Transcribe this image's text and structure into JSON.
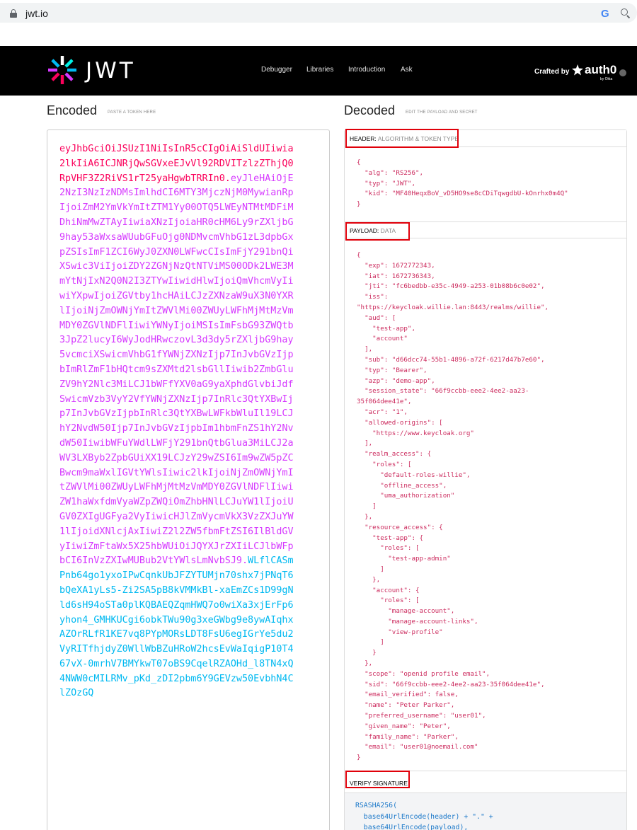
{
  "browser": {
    "url": "jwt.io",
    "google_icon": "G"
  },
  "header": {
    "logo_text": "JWT",
    "nav": [
      "Debugger",
      "Libraries",
      "Introduction",
      "Ask"
    ],
    "crafted_by": "Crafted by",
    "brand": "auth0",
    "brand_sub": "by Okta"
  },
  "encoded": {
    "title": "Encoded",
    "subtitle": "PASTE A TOKEN HERE",
    "token_header": "eyJhbGciOiJSUzI1NiIsInR5cCIgOiAiSldUIiwia2lkIiA6ICJNRjQwSGVxeEJvVl92RDVITzlzZThjQ0RpVHF3Z2RiVS1rT25yaHgwbTRRIn0",
    "token_payload": "eyJleHAiOjE2NzI3NzIzNDMsImlhdCI6MTY3MjczNjM0MywianRpIjoiZmM2YmVkYmItZTM1Yy00OTQ5LWEyNTMtMDFiMDhiNmMwZTAyIiwiaXNzIjoiaHR0cHM6Ly9rZXljbG9hay53aWxsaWUubGFuOjg0NDMvcmVhbG1zL3dpbGxpZSIsImF1ZCI6WyJ0ZXN0LWFwcCIsImFjY291bnQiXSwic3ViIjoiZDY2ZGNjNzQtNTViMS00ODk2LWE3MmYtNjIxN2Q0N2I3ZTYwIiwidHlwIjoiQmVhcmVyIiwiYXpwIjoiZGVtby1hcHAiLCJzZXNzaW9uX3N0YXRlIjoiNjZmOWNjYmItZWVlMi00ZWUyLWFhMjMtMzVmMDY0ZGVlNDFlIiwiYWNyIjoiMSIsImFsbG93ZWQtb3JpZ2lucyI6WyJodHRwczovL3d3dy5rZXljbG9hay5vcmciXSwicmVhbG1fYWNjZXNzIjp7InJvbGVzIjpbImRlZmF1bHQtcm9sZXMtd2lsbGllIiwib2ZmbGluZV9hY2Nlc3MiLCJ1bWFfYXV0aG9yaXphdGlvbiJdfSwicmVzb3VyY2VfYWNjZXNzIjp7InRlc3QtYXBwIjp7InJvbGVzIjpbInRlc3QtYXBwLWFkbWluIl19LCJhY2NvdW50Ijp7InJvbGVzIjpbIm1hbmFnZS1hY2NvdW50IiwibWFuYWdlLWFjY291bnQtbGlua3MiLCJ2aWV3LXByb2ZpbGUiXX19LCJzY29wZSI6Im9wZW5pZCBwcm9maWxlIGVtYWlsIiwic2lkIjoiNjZmOWNjYmItZWVlMi00ZWUyLWFhMjMtMzVmMDY0ZGVlNDFlIiwiZW1haWxfdmVyaWZpZWQiOmZhbHNlLCJuYW1lIjoiUGV0ZXIgUGFya2VyIiwicHJlZmVycmVkX3VzZXJuYW1lIjoidXNlcjAxIiwiZ2l2ZW5fbmFtZSI6IlBldGVyIiwiZmFtaWx5X25hbWUiOiJQYXJrZXIiLCJlbWFpbCI6InVzZXIwMUBub2VtYWlsLmNvbSJ9",
    "token_signature": "WLflCASmPnb64go1yxoIPwCqnkUbJFZYTUMjn70shx7jPNqT6bQeXA1yLs5-Zi2SA5pB8kVMMkBl-xaEmZCs1D99gNld6sH94oSTa0plKQBAEQZqmHWQ7o0wiXa3xjErFp6yhon4_GMHKUCgi6obkTWu90g3xeGWbg9e8ywAIqhxAZOrRLfR1KE7vq8PYpMORsLDT8FsU6egIGrYe5du2VyRITfhjdyZ0WllWbBZuHRoW2hcsEvWaIqigP10T467vX-0mrhV7BMYkwT07oBS9CqelRZAOHd_l8TN4xQ4NWW0cMILRMv_pKd_zDI2pbm6Y9GEVzw50EvbhN4ClZOzGQ",
    "dot": "."
  },
  "decoded": {
    "title": "Decoded",
    "subtitle": "EDIT THE PAYLOAD AND SECRET",
    "header_section": {
      "label": "HEADER:",
      "muted": "ALGORITHM & TOKEN TYPE"
    },
    "header_json": "{\n  \"alg\": \"RS256\",\n  \"typ\": \"JWT\",\n  \"kid\": \"MF40HeqxBoV_vD5HO9se8cCDiTqwgdbU-kOnrhx0m4Q\"\n}",
    "payload_section": {
      "label": "PAYLOAD:",
      "muted": "DATA"
    },
    "payload_json": "{\n  \"exp\": 1672772343,\n  \"iat\": 1672736343,\n  \"jti\": \"fc6bedbb-e35c-4949-a253-01b08b6c0e02\",\n  \"iss\":\n\"https://keycloak.willie.lan:8443/realms/willie\",\n  \"aud\": [\n    \"test-app\",\n    \"account\"\n  ],\n  \"sub\": \"d66dcc74-55b1-4896-a72f-6217d47b7e60\",\n  \"typ\": \"Bearer\",\n  \"azp\": \"demo-app\",\n  \"session_state\": \"66f9ccbb-eee2-4ee2-aa23-\n35f064dee41e\",\n  \"acr\": \"1\",\n  \"allowed-origins\": [\n    \"https://www.keycloak.org\"\n  ],\n  \"realm_access\": {\n    \"roles\": [\n      \"default-roles-willie\",\n      \"offline_access\",\n      \"uma_authorization\"\n    ]\n  },\n  \"resource_access\": {\n    \"test-app\": {\n      \"roles\": [\n        \"test-app-admin\"\n      ]\n    },\n    \"account\": {\n      \"roles\": [\n        \"manage-account\",\n        \"manage-account-links\",\n        \"view-profile\"\n      ]\n    }\n  },\n  \"scope\": \"openid profile email\",\n  \"sid\": \"66f9ccbb-eee2-4ee2-aa23-35f064dee41e\",\n  \"email_verified\": false,\n  \"name\": \"Peter Parker\",\n  \"preferred_username\": \"user01\",\n  \"given_name\": \"Peter\",\n  \"family_name\": \"Parker\",\n  \"email\": \"user01@noemail.com\"\n}",
    "signature_section": {
      "label": "VERIFY SIGNATURE"
    },
    "signature_code": "RSASHA256(\n  base64UrlEncode(header) + \".\" +\n  base64UrlEncode(payload),"
  },
  "colors": {
    "token_header": "#fb015b",
    "token_payload": "#d63aff",
    "token_signature": "#00b9f1",
    "highlight": "#e0000a"
  }
}
